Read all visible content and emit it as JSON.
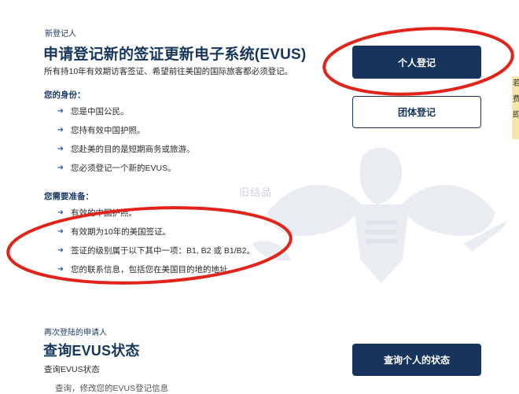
{
  "new_registrant": {
    "eyebrow": "新登记人",
    "headline": "申请登记新的签证更新电子系统(EVUS)",
    "description": "所有持10年有效期访客签证、希望前往美国的国际旅客都必须登记。",
    "identity_label": "您的身份：",
    "identity_items": [
      "您是中国公民。",
      "您持有效中国护照。",
      "您赴美的目的是短期商务或旅游。",
      "您必须登记一个新的EVUS。"
    ],
    "prepare_label": "您需要准备：",
    "prepare_items": [
      "有效的中国护照。",
      "有效期为10年的美国签证。",
      "签证的级别属于以下其中一项：B1, B2 或 B1/B2。",
      "您的联系信息，包括您在美国目的地的地址。"
    ]
  },
  "buttons": {
    "individual": "个人登记",
    "group": "团体登记",
    "check_status": "查询个人的状态"
  },
  "returning": {
    "eyebrow": "再次登陆的申请人",
    "headline": "查询EVUS状态",
    "description": "查询EVUS状态",
    "cut_line": "查询，修改您的EVUS登记信息"
  },
  "watermark": "旧结品",
  "edge_note": [
    "若",
    "费",
    "即"
  ],
  "icons": {
    "bullet": "arrow-right-icon",
    "seal": "eagle-seal-icon"
  },
  "colors": {
    "navy": "#17355c",
    "annotation_red": "#e2231a",
    "sidebar_yellow": "#f6e7a5"
  }
}
